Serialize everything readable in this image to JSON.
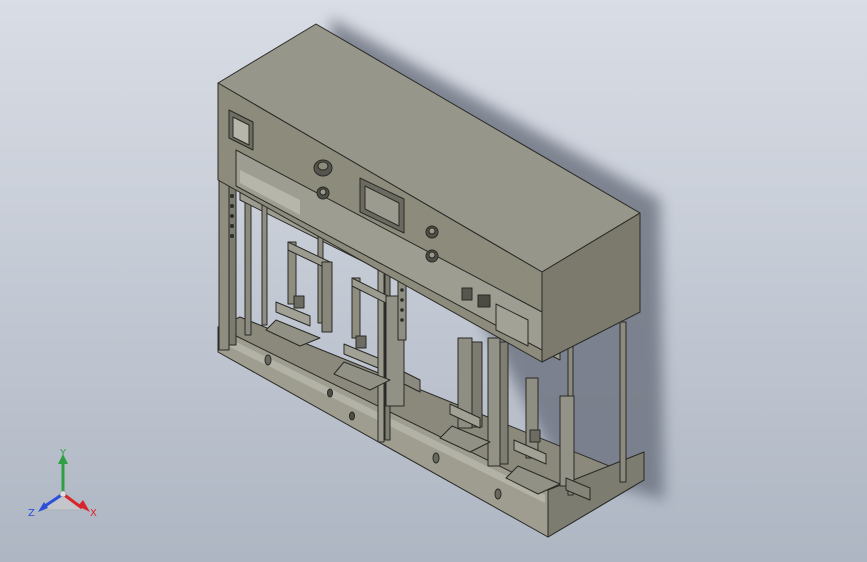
{
  "viewport": {
    "background_top": "#d9dde5",
    "background_bottom": "#aeb6c3"
  },
  "model": {
    "colors": {
      "body_front": "#8c8b7c",
      "body_top": "#97968a",
      "body_side": "#7b7a6d",
      "edge": "#2a2a26",
      "shadow": "#707784",
      "screen": "#9c9b90",
      "knob": "#55554d"
    }
  },
  "triad": {
    "x_label": "X",
    "y_label": "Y",
    "z_label": "Z",
    "x_color": "#d8262a",
    "y_color": "#2ea043",
    "z_color": "#2b4fd8"
  }
}
